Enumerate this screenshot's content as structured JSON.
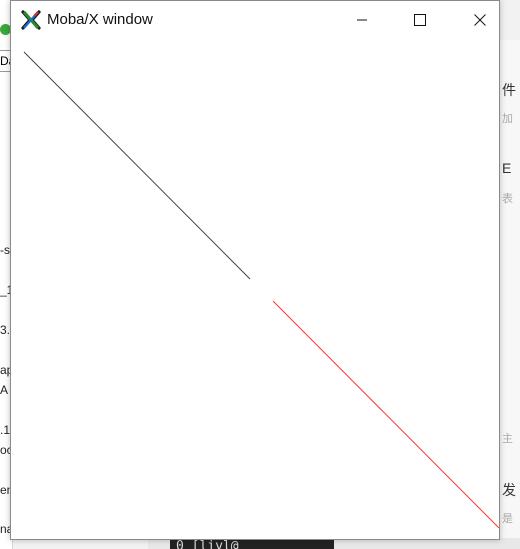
{
  "window": {
    "title": "Moba/X window",
    "buttons": {
      "minimize": "minimize",
      "maximize": "maximize",
      "close": "close"
    }
  },
  "canvas": {
    "lines": [
      {
        "name": "black-line",
        "color": "#444444"
      },
      {
        "name": "red-line",
        "color": "#ff3333"
      }
    ]
  },
  "background": {
    "left_fragments": [
      "Da",
      "-s",
      "_1",
      "3.",
      "ap",
      "A",
      ".1",
      "oc",
      "ent",
      "na"
    ],
    "right_fragments": [
      "件",
      "加",
      "E",
      "表",
      "主",
      "发",
      "是"
    ],
    "terminal_text": "0 [liyl@"
  },
  "colors": {
    "titlebar_bg": "#ffffff",
    "window_border": "#8a8a8a",
    "line_black": "#444444",
    "line_red": "#ff3333"
  }
}
